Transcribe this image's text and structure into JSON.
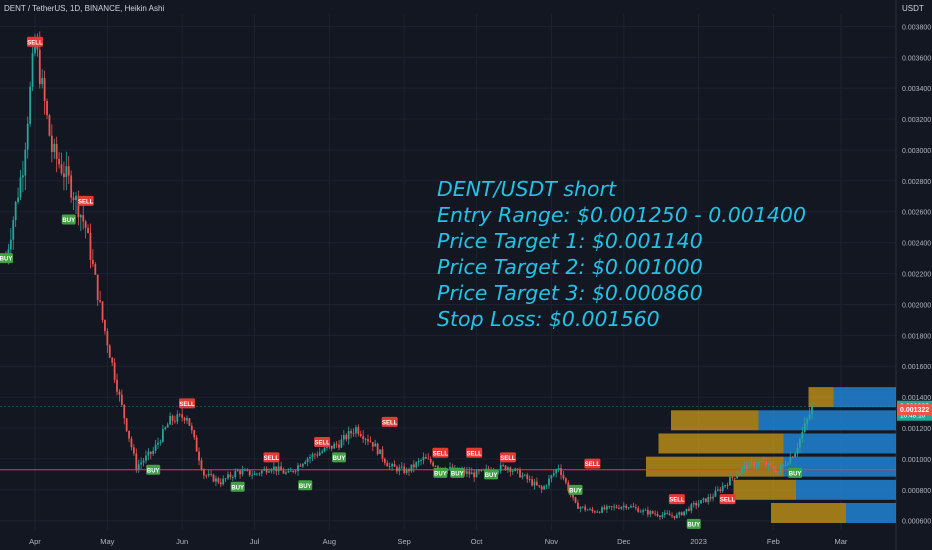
{
  "header": {
    "title": "DENT / TetherUS, 1D, BINANCE, Heikin Ashi",
    "unit": "USDT"
  },
  "annotation": [
    "DENT/USDT short",
    "Entry Range: $0.001250 - 0.001400",
    "Price Target 1: $0.001140",
    "Price Target 2: $0.001000",
    "Price Target 3: $0.000860",
    "Stop Loss: $0.001560"
  ],
  "colors": {
    "background": "#131722",
    "up": "#26a69a",
    "down": "#ef5350",
    "annotation": "#22c3e6",
    "hline": "#f23645",
    "vp_up": "#d4a017",
    "vp_down": "#2196f3"
  },
  "chart_data": {
    "type": "candlestick",
    "title": "DENT / TetherUS, 1D, BINANCE, Heikin Ashi",
    "ylabel": "USDT",
    "ylim": [
      0.00054,
      0.00388
    ],
    "x_ticks": [
      "Apr",
      "May",
      "Jun",
      "Jul",
      "Aug",
      "Sep",
      "Oct",
      "Nov",
      "Dec",
      "2023",
      "Feb",
      "Mar"
    ],
    "y_ticks": [
      "0.000600",
      "0.000800",
      "0.001000",
      "0.001200",
      "0.001400",
      "0.001600",
      "0.001800",
      "0.002000",
      "0.002200",
      "0.002400",
      "0.002600",
      "0.002800",
      "0.003000",
      "0.003200",
      "0.003400",
      "0.003600",
      "0.003800"
    ],
    "horizontal_line": 0.00093,
    "price_labels": [
      {
        "value": "0.001338",
        "subtext": "10:48:10",
        "color": "#26a69a"
      },
      {
        "value": "0.001322",
        "color": "#ef5350"
      }
    ],
    "series": [
      {
        "date": "Mar 20",
        "close": 0.0023
      },
      {
        "date": "Mar 27",
        "close": 0.0029
      },
      {
        "date": "Apr 1",
        "close": 0.0037
      },
      {
        "date": "Apr 8",
        "close": 0.003
      },
      {
        "date": "Apr 15",
        "close": 0.0028
      },
      {
        "date": "Apr 22",
        "close": 0.0025
      },
      {
        "date": "Apr 29",
        "close": 0.0019
      },
      {
        "date": "May 6",
        "close": 0.0014
      },
      {
        "date": "May 13",
        "close": 0.00095
      },
      {
        "date": "May 20",
        "close": 0.00105
      },
      {
        "date": "May 27",
        "close": 0.00125
      },
      {
        "date": "Jun 3",
        "close": 0.00128
      },
      {
        "date": "Jun 10",
        "close": 0.0009
      },
      {
        "date": "Jun 17",
        "close": 0.00085
      },
      {
        "date": "Jun 24",
        "close": 0.00092
      },
      {
        "date": "Jul 1",
        "close": 0.0009
      },
      {
        "date": "Jul 8",
        "close": 0.00095
      },
      {
        "date": "Jul 15",
        "close": 0.0009
      },
      {
        "date": "Jul 22",
        "close": 0.001
      },
      {
        "date": "Jul 29",
        "close": 0.00105
      },
      {
        "date": "Aug 5",
        "close": 0.0011
      },
      {
        "date": "Aug 12",
        "close": 0.0012
      },
      {
        "date": "Aug 19",
        "close": 0.0011
      },
      {
        "date": "Aug 26",
        "close": 0.00095
      },
      {
        "date": "Sep 2",
        "close": 0.00092
      },
      {
        "date": "Sep 9",
        "close": 0.001
      },
      {
        "date": "Sep 16",
        "close": 0.00095
      },
      {
        "date": "Sep 23",
        "close": 0.00092
      },
      {
        "date": "Sep 30",
        "close": 0.0009
      },
      {
        "date": "Oct 7",
        "close": 0.00093
      },
      {
        "date": "Oct 14",
        "close": 0.00095
      },
      {
        "date": "Oct 21",
        "close": 0.00088
      },
      {
        "date": "Oct 28",
        "close": 0.0008
      },
      {
        "date": "Nov 4",
        "close": 0.00095
      },
      {
        "date": "Nov 11",
        "close": 0.0007
      },
      {
        "date": "Nov 18",
        "close": 0.00066
      },
      {
        "date": "Nov 25",
        "close": 0.00068
      },
      {
        "date": "Dec 2",
        "close": 0.0007
      },
      {
        "date": "Dec 9",
        "close": 0.00066
      },
      {
        "date": "Dec 16",
        "close": 0.00064
      },
      {
        "date": "Dec 23",
        "close": 0.00063
      },
      {
        "date": "Dec 30",
        "close": 0.0007
      },
      {
        "date": "Jan 6",
        "close": 0.00075
      },
      {
        "date": "Jan 13",
        "close": 0.00085
      },
      {
        "date": "Jan 20",
        "close": 0.00095
      },
      {
        "date": "Jan 27",
        "close": 0.00098
      },
      {
        "date": "Feb 3",
        "close": 0.00092
      },
      {
        "date": "Feb 10",
        "close": 0.00105
      },
      {
        "date": "Feb 17",
        "close": 0.00133
      }
    ],
    "signals": [
      {
        "label": "BUY",
        "date": "Mar 20",
        "price": 0.0023
      },
      {
        "label": "SELL",
        "date": "Apr 1",
        "price": 0.0037
      },
      {
        "label": "SELL",
        "date": "Apr 22",
        "price": 0.00267
      },
      {
        "label": "BUY",
        "date": "Apr 15",
        "price": 0.00255
      },
      {
        "label": "BUY",
        "date": "May 20",
        "price": 0.00093
      },
      {
        "label": "SELL",
        "date": "Jun 3",
        "price": 0.00136
      },
      {
        "label": "BUY",
        "date": "Jun 24",
        "price": 0.00082
      },
      {
        "label": "SELL",
        "date": "Jul 8",
        "price": 0.00101
      },
      {
        "label": "BUY",
        "date": "Jul 22",
        "price": 0.00083
      },
      {
        "label": "SELL",
        "date": "Jul 29",
        "price": 0.00111
      },
      {
        "label": "BUY",
        "date": "Aug 5",
        "price": 0.00101
      },
      {
        "label": "SELL",
        "date": "Aug 26",
        "price": 0.00124
      },
      {
        "label": "SELL",
        "date": "Sep 16",
        "price": 0.00104
      },
      {
        "label": "BUY",
        "date": "Sep 16",
        "price": 0.00091
      },
      {
        "label": "BUY",
        "date": "Sep 23",
        "price": 0.00091
      },
      {
        "label": "SELL",
        "date": "Sep 30",
        "price": 0.00104
      },
      {
        "label": "BUY",
        "date": "Oct 7",
        "price": 0.0009
      },
      {
        "label": "SELL",
        "date": "Oct 14",
        "price": 0.00101
      },
      {
        "label": "BUY",
        "date": "Nov 11",
        "price": 0.0008
      },
      {
        "label": "SELL",
        "date": "Nov 18",
        "price": 0.00097
      },
      {
        "label": "SELL",
        "date": "Dec 23",
        "price": 0.00074
      },
      {
        "label": "BUY",
        "date": "Dec 30",
        "price": 0.00058
      },
      {
        "label": "SELL",
        "date": "Jan 13",
        "price": 0.00074
      },
      {
        "label": "BUY",
        "date": "Feb 10",
        "price": 0.00091
      }
    ],
    "volume_profile": [
      {
        "price": 0.00065,
        "up": 0.3,
        "down": 0.2
      },
      {
        "price": 0.0008,
        "up": 0.25,
        "down": 0.4
      },
      {
        "price": 0.00095,
        "up": 0.55,
        "down": 0.45
      },
      {
        "price": 0.0011,
        "up": 0.5,
        "down": 0.45
      },
      {
        "price": 0.00125,
        "up": 0.35,
        "down": 0.55
      },
      {
        "price": 0.0014,
        "up": 0.1,
        "down": 0.25
      }
    ]
  }
}
